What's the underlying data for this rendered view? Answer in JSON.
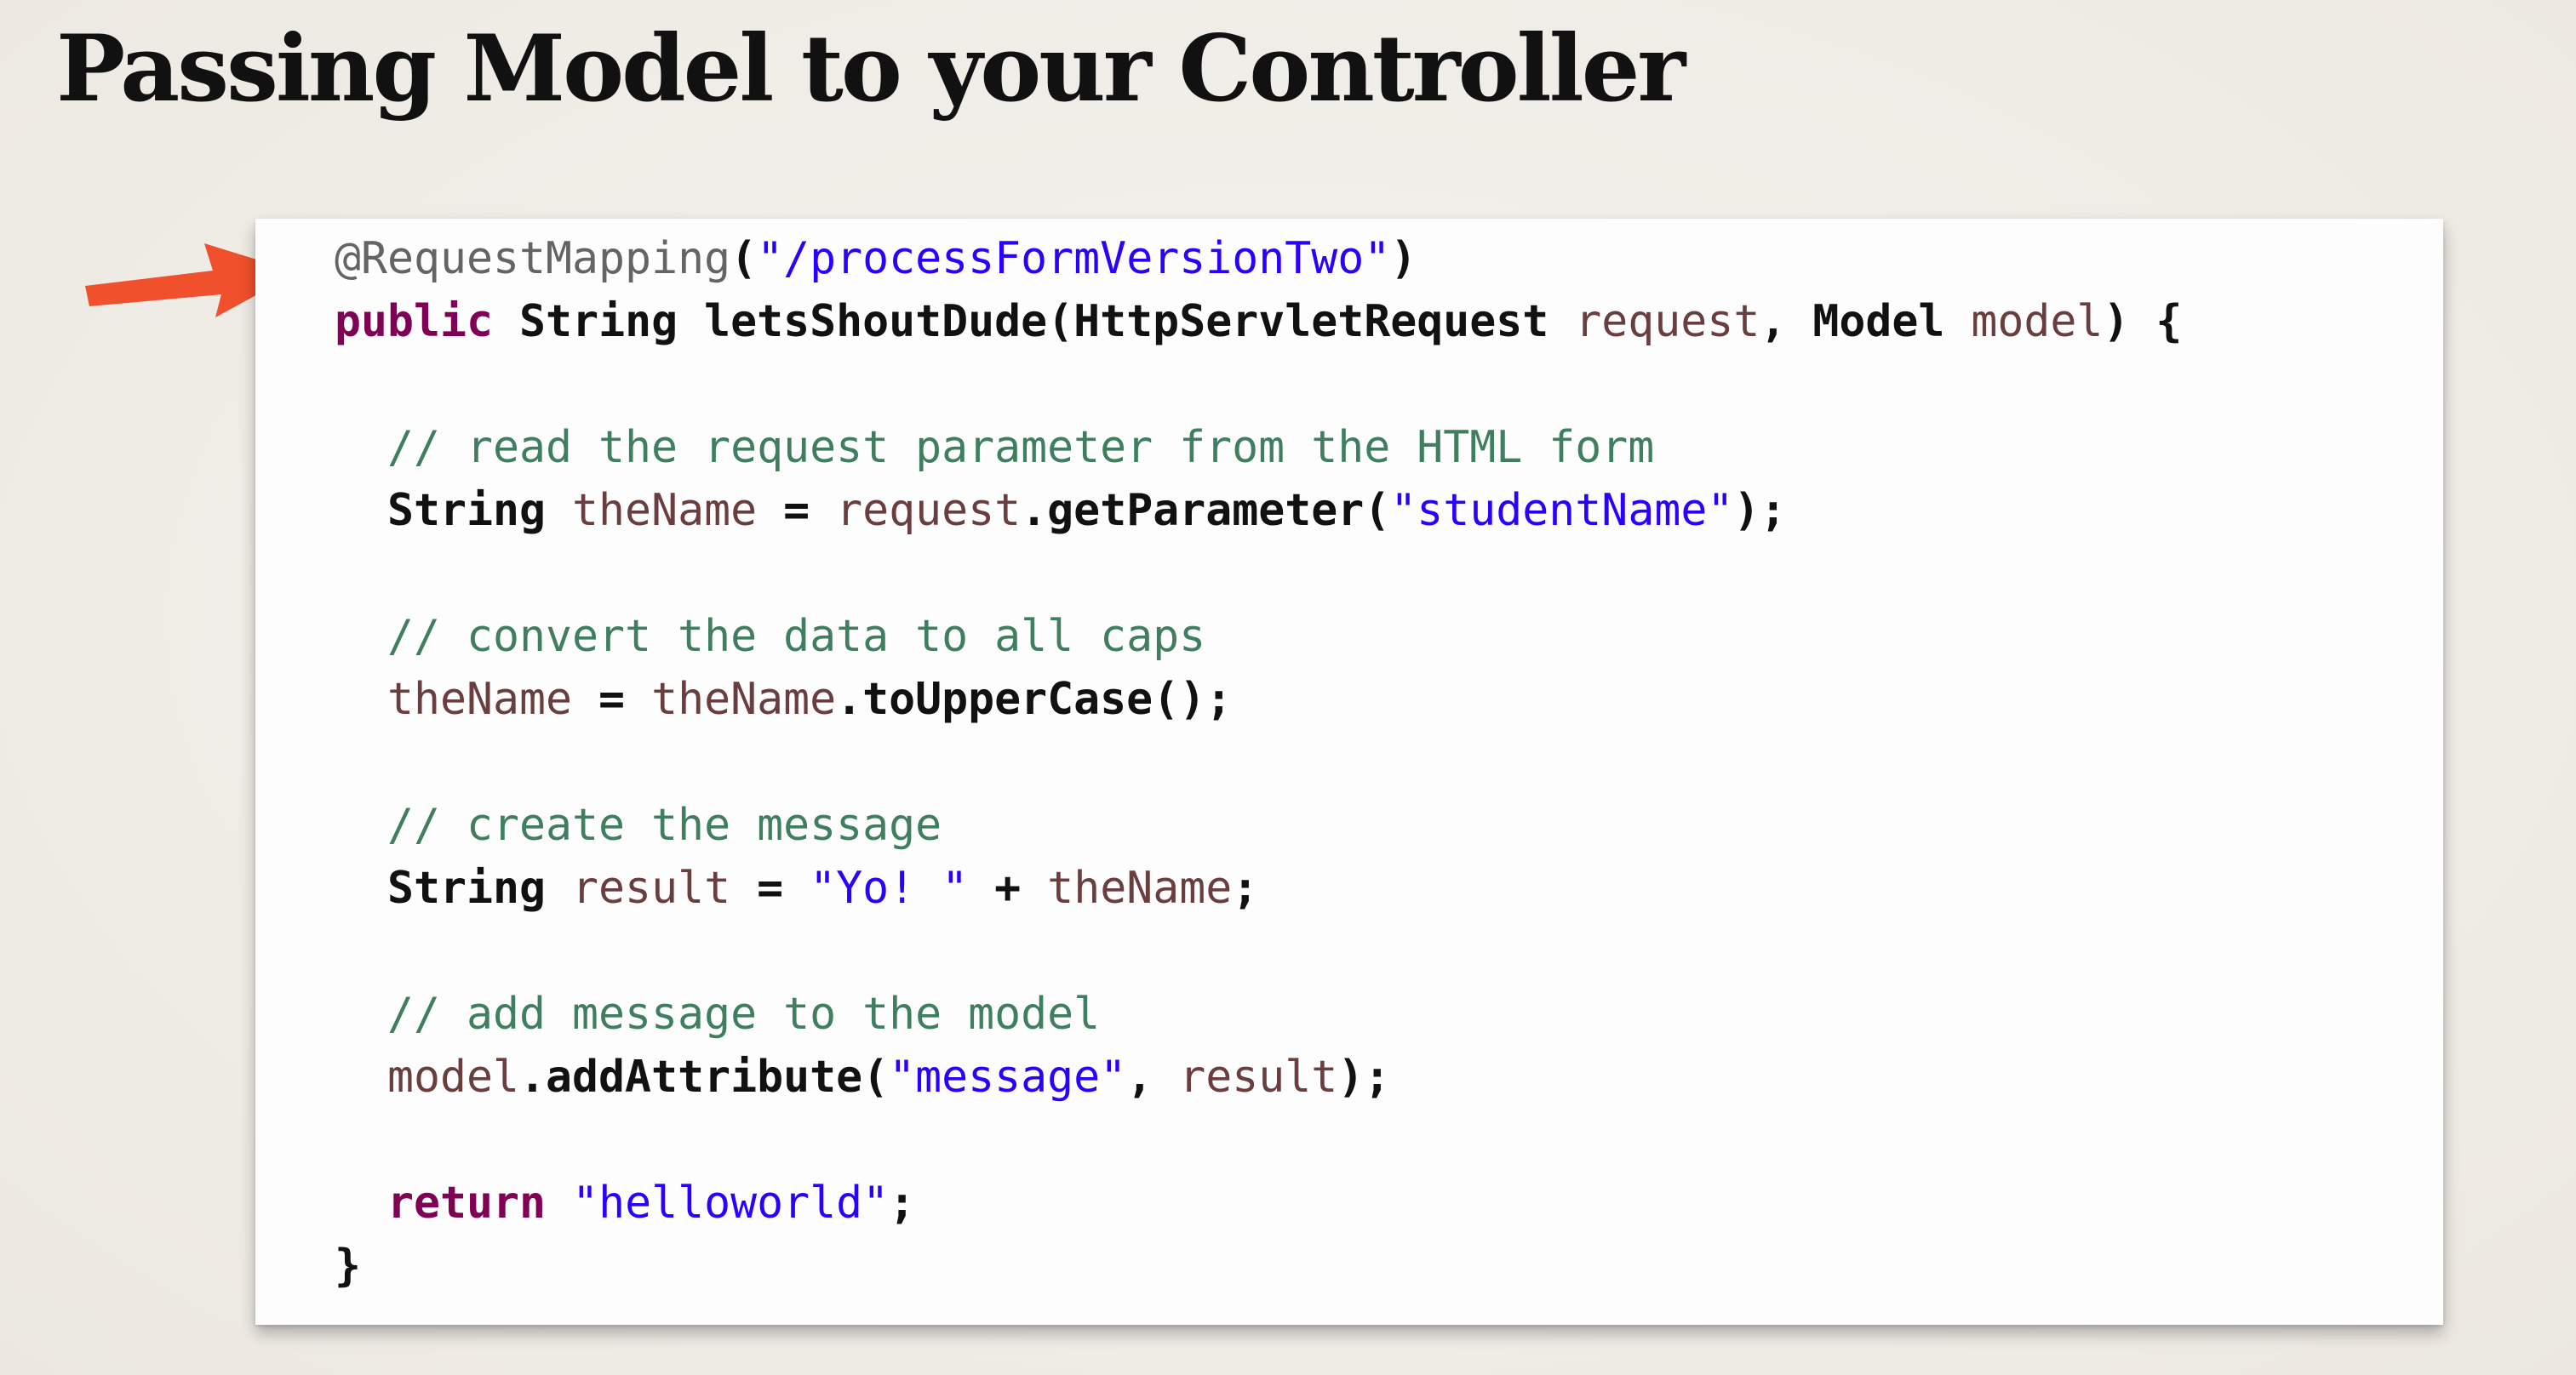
{
  "slide": {
    "title": "Passing Model to your Controller"
  },
  "code": {
    "lines": [
      {
        "indent": 0,
        "tokens": [
          {
            "t": "annotation",
            "v": "@RequestMapping"
          },
          {
            "t": "plain",
            "v": "("
          },
          {
            "t": "string",
            "v": "\"/processFormVersionTwo\""
          },
          {
            "t": "plain",
            "v": ")"
          }
        ]
      },
      {
        "indent": 0,
        "tokens": [
          {
            "t": "keyword",
            "v": "public"
          },
          {
            "t": "plain",
            "v": " String letsShoutDude(HttpServletRequest "
          },
          {
            "t": "var",
            "v": "request"
          },
          {
            "t": "plain",
            "v": ", Model "
          },
          {
            "t": "var",
            "v": "model"
          },
          {
            "t": "plain",
            "v": ") {"
          }
        ]
      },
      {
        "indent": 0,
        "tokens": []
      },
      {
        "indent": 1,
        "tokens": [
          {
            "t": "comment",
            "v": "// read the request parameter from the HTML form"
          }
        ]
      },
      {
        "indent": 1,
        "tokens": [
          {
            "t": "plain",
            "v": "String "
          },
          {
            "t": "var",
            "v": "theName"
          },
          {
            "t": "plain",
            "v": " = "
          },
          {
            "t": "var",
            "v": "request"
          },
          {
            "t": "plain",
            "v": ".getParameter("
          },
          {
            "t": "string",
            "v": "\"studentName\""
          },
          {
            "t": "plain",
            "v": ");"
          }
        ]
      },
      {
        "indent": 0,
        "tokens": []
      },
      {
        "indent": 1,
        "tokens": [
          {
            "t": "comment",
            "v": "// convert the data to all caps"
          }
        ]
      },
      {
        "indent": 1,
        "tokens": [
          {
            "t": "var",
            "v": "theName"
          },
          {
            "t": "plain",
            "v": " = "
          },
          {
            "t": "var",
            "v": "theName"
          },
          {
            "t": "plain",
            "v": ".toUpperCase();"
          }
        ]
      },
      {
        "indent": 0,
        "tokens": []
      },
      {
        "indent": 1,
        "tokens": [
          {
            "t": "comment",
            "v": "// create the message"
          }
        ]
      },
      {
        "indent": 1,
        "tokens": [
          {
            "t": "plain",
            "v": "String "
          },
          {
            "t": "var",
            "v": "result"
          },
          {
            "t": "plain",
            "v": " = "
          },
          {
            "t": "string",
            "v": "\"Yo! \""
          },
          {
            "t": "plain",
            "v": " + "
          },
          {
            "t": "var",
            "v": "theName"
          },
          {
            "t": "plain",
            "v": ";"
          }
        ]
      },
      {
        "indent": 0,
        "tokens": []
      },
      {
        "indent": 1,
        "tokens": [
          {
            "t": "comment",
            "v": "// add message to the model"
          }
        ]
      },
      {
        "indent": 1,
        "tokens": [
          {
            "t": "var",
            "v": "model"
          },
          {
            "t": "plain",
            "v": ".addAttribute("
          },
          {
            "t": "string",
            "v": "\"message\""
          },
          {
            "t": "plain",
            "v": ", "
          },
          {
            "t": "var",
            "v": "result"
          },
          {
            "t": "plain",
            "v": ");"
          }
        ]
      },
      {
        "indent": 0,
        "tokens": []
      },
      {
        "indent": 1,
        "tokens": [
          {
            "t": "keyword",
            "v": "return"
          },
          {
            "t": "plain",
            "v": " "
          },
          {
            "t": "string",
            "v": "\"helloworld\""
          },
          {
            "t": "plain",
            "v": ";"
          }
        ]
      },
      {
        "indent": 0,
        "tokens": [
          {
            "t": "plain",
            "v": "}"
          }
        ]
      }
    ]
  },
  "colors": {
    "background": "#efece6",
    "arrow": "#f0502c",
    "annotation": "#646464",
    "keyword": "#7f0055",
    "string": "#2a00ff",
    "variable": "#6a3e3e",
    "comment": "#3f7f5f"
  },
  "icons": {
    "pointer": "arrow-right-icon"
  }
}
